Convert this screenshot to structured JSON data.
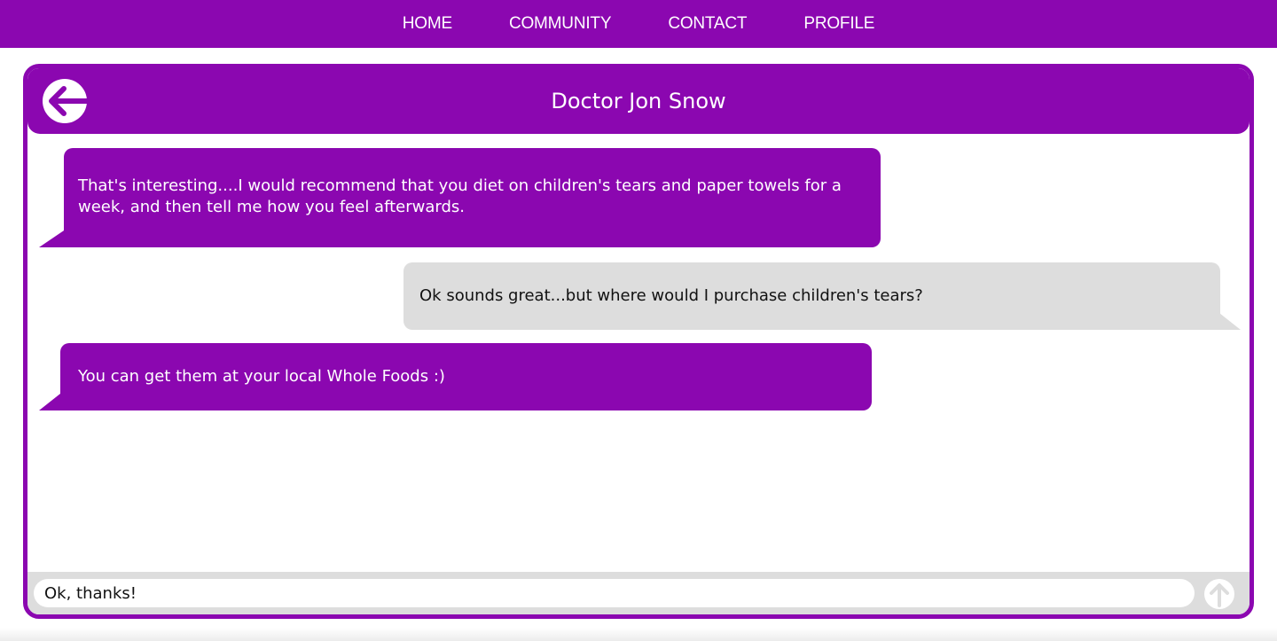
{
  "nav": {
    "items": [
      {
        "label": "HOME"
      },
      {
        "label": "COMMUNITY"
      },
      {
        "label": "CONTACT"
      },
      {
        "label": "PROFILE"
      }
    ]
  },
  "chat": {
    "title": "Doctor Jon Snow",
    "back_icon": "arrow-left-circle-icon",
    "send_icon": "arrow-up-circle-icon",
    "messages": [
      {
        "sender": "doctor",
        "text": "That's interesting....I would recommend that you diet on children's tears and paper towels for a week, and then tell me how you feel afterwards."
      },
      {
        "sender": "user",
        "text": "Ok sounds great...but where would I purchase children's tears?"
      },
      {
        "sender": "doctor",
        "text": "You can get them at your local Whole Foods :)"
      }
    ],
    "input": {
      "value": "Ok, thanks!"
    }
  },
  "colors": {
    "accent": "#8b07b0",
    "user_bubble": "#dddddd",
    "background": "#ffffff"
  }
}
